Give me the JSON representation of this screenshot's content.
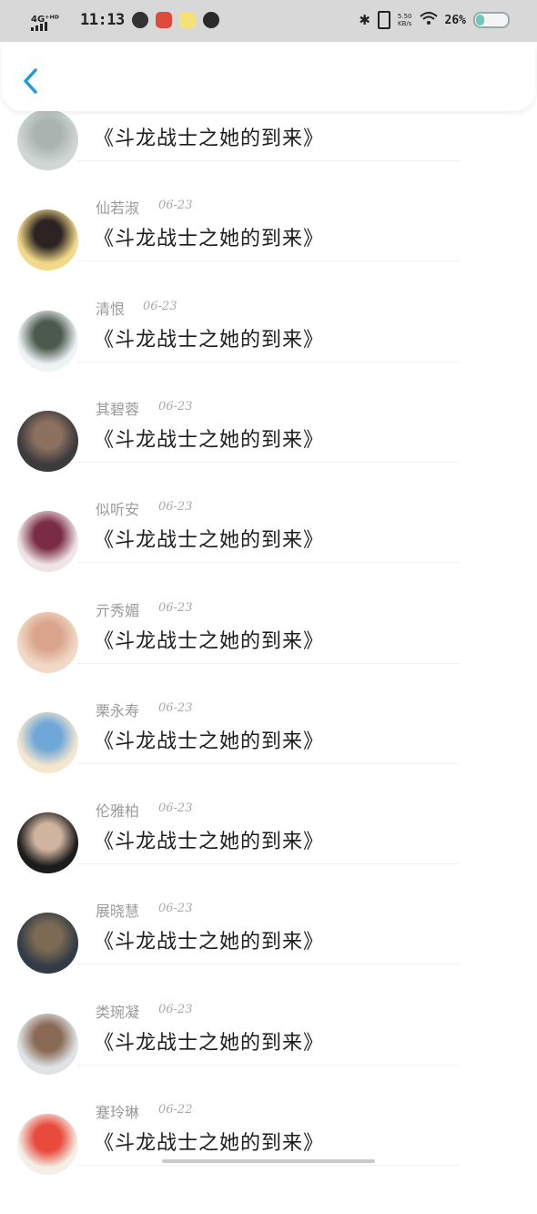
{
  "status_bar": {
    "network": "4G⁺ᴴᴰ",
    "time": "11:13",
    "speed_value": "5.50",
    "speed_unit": "KB/s",
    "battery_text": "26%",
    "battery_level": 0.26
  },
  "header": {
    "back_icon": "chevron-left-icon",
    "accent_color": "#1e9be0"
  },
  "items": [
    {
      "name": "",
      "date": "",
      "title": "《斗龙战士之她的到来》",
      "avatar_colors": [
        "#cfd6d4",
        "#a9b4b0"
      ]
    },
    {
      "name": "仙若淑",
      "date": "06-23",
      "title": "《斗龙战士之她的到来》",
      "avatar_colors": [
        "#f2d98a",
        "#2d2322"
      ]
    },
    {
      "name": "清恨",
      "date": "06-23",
      "title": "《斗龙战士之她的到来》",
      "avatar_colors": [
        "#eef3f6",
        "#4a5a4d"
      ]
    },
    {
      "name": "其碧蓉",
      "date": "06-23",
      "title": "《斗龙战士之她的到来》",
      "avatar_colors": [
        "#3b3a3d",
        "#8c7060"
      ]
    },
    {
      "name": "似听安",
      "date": "06-23",
      "title": "《斗龙战士之她的到来》",
      "avatar_colors": [
        "#efe4e6",
        "#7a2b45"
      ]
    },
    {
      "name": "亓秀媚",
      "date": "06-23",
      "title": "《斗龙战士之她的到来》",
      "avatar_colors": [
        "#f1d9c6",
        "#d9a48b"
      ]
    },
    {
      "name": "栗永寿",
      "date": "06-23",
      "title": "《斗龙战士之她的到来》",
      "avatar_colors": [
        "#f4e6cf",
        "#6fa7d8"
      ]
    },
    {
      "name": "伦雅柏",
      "date": "06-23",
      "title": "《斗龙战士之她的到来》",
      "avatar_colors": [
        "#1c1c1c",
        "#cfb49f"
      ]
    },
    {
      "name": "展晓慧",
      "date": "06-23",
      "title": "《斗龙战士之她的到来》",
      "avatar_colors": [
        "#323c46",
        "#7c6a54"
      ]
    },
    {
      "name": "类琬凝",
      "date": "06-23",
      "title": "《斗龙战士之她的到来》",
      "avatar_colors": [
        "#dfe3e6",
        "#8a6a55"
      ]
    },
    {
      "name": "蹇玲琳",
      "date": "06-22",
      "title": "《斗龙战士之她的到来》",
      "avatar_colors": [
        "#f3efe7",
        "#e84b3c"
      ]
    }
  ]
}
